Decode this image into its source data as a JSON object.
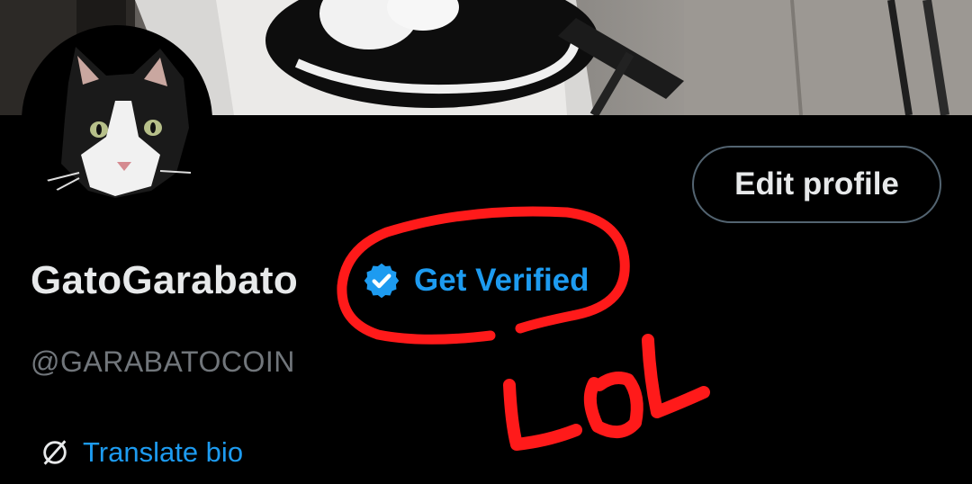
{
  "profile": {
    "display_name": "GatoGarabato",
    "get_verified_label": "Get Verified",
    "handle": "@GARABATOCOIN",
    "edit_profile_label": "Edit profile",
    "translate_bio_label": "Translate bio"
  },
  "annotation": {
    "text": "LOL"
  },
  "colors": {
    "background": "#000000",
    "primary_text": "#e7e9ea",
    "secondary_text": "#71767b",
    "accent_blue": "#1d9bf0",
    "button_border": "#536471",
    "scribble_red": "#ff1a1a"
  },
  "icons": {
    "verified": "verified-badge-icon",
    "translate": "translate-globe-icon"
  }
}
